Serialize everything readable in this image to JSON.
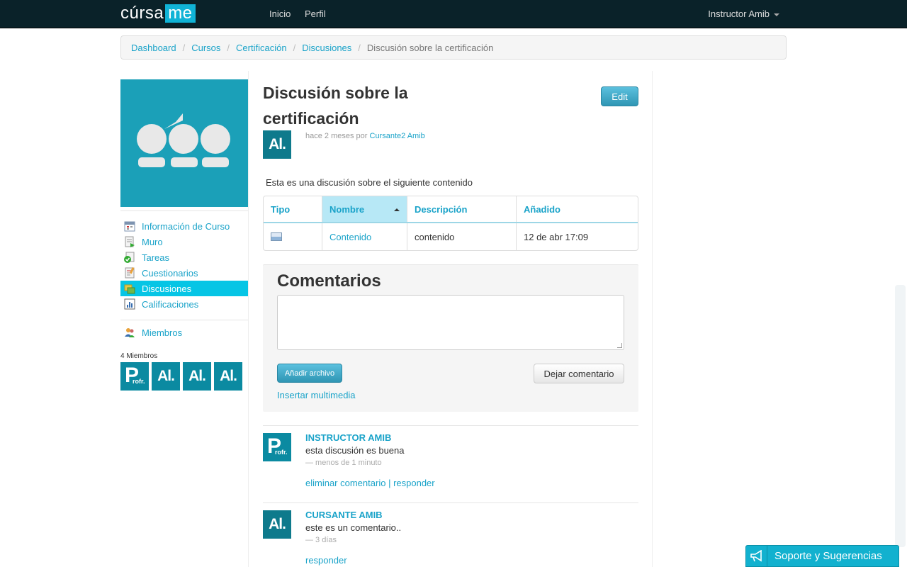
{
  "nav": {
    "logo_left": "cúrsa",
    "logo_right": "me",
    "links": [
      "Inicio",
      "Perfil"
    ],
    "user": "Instructor Amib"
  },
  "breadcrumb": [
    "Dashboard",
    "Cursos",
    "Certificación",
    "Discusiones",
    "Discusión sobre la certificación"
  ],
  "sidebar": {
    "items": [
      {
        "label": "Información de Curso",
        "icon": "calendar-icon"
      },
      {
        "label": "Muro",
        "icon": "wall-post-icon"
      },
      {
        "label": "Tareas",
        "icon": "task-check-icon"
      },
      {
        "label": "Cuestionarios",
        "icon": "quiz-icon"
      },
      {
        "label": "Discusiones",
        "icon": "discussion-icon",
        "active": true
      },
      {
        "label": "Calificaciones",
        "icon": "grades-chart-icon"
      }
    ],
    "members_label": "Miembros",
    "members_count": "4 Miembros",
    "avatar_profr_letter": "P",
    "avatar_profr_sub": "rofr.",
    "avatar_student_text": "Al."
  },
  "discussion": {
    "title": "Discusión sobre la certificación",
    "edit_label": "Edit",
    "meta_prefix": "hace 2 meses por",
    "author": "Cursante2 Amib",
    "intro": "Esta es una discusión sobre el siguiente contenido"
  },
  "content_table": {
    "headers": [
      "Tipo",
      "Nombre",
      "Descripción",
      "Añadido"
    ],
    "row": {
      "type_icon": "image-file-icon",
      "nombre": "Contenido",
      "descripcion": "contenido",
      "anadido": "12 de abr 17:09"
    }
  },
  "comments_form": {
    "title": "Comentarios",
    "attach_label": "Añadir archivo",
    "submit_label": "Dejar comentario",
    "insert_media": "Insertar multimedia"
  },
  "comments": [
    {
      "author": "INSTRUCTOR AMIB",
      "text": "esta discusión es buena",
      "time": "— menos de 1 minuto",
      "delete": "eliminar comentario",
      "sep": "|",
      "reply": "responder"
    },
    {
      "author": "CURSANTE AMIB",
      "text": "este es un comentario..",
      "time": "— 3 días",
      "reply": "responder"
    }
  ],
  "support": {
    "label": "Soporte y Sugerencias"
  },
  "colors": {
    "accent": "#1aa3c9",
    "navbar": "#0a2229",
    "active": "#06c5e5",
    "avatar": "#0b8aa1"
  }
}
